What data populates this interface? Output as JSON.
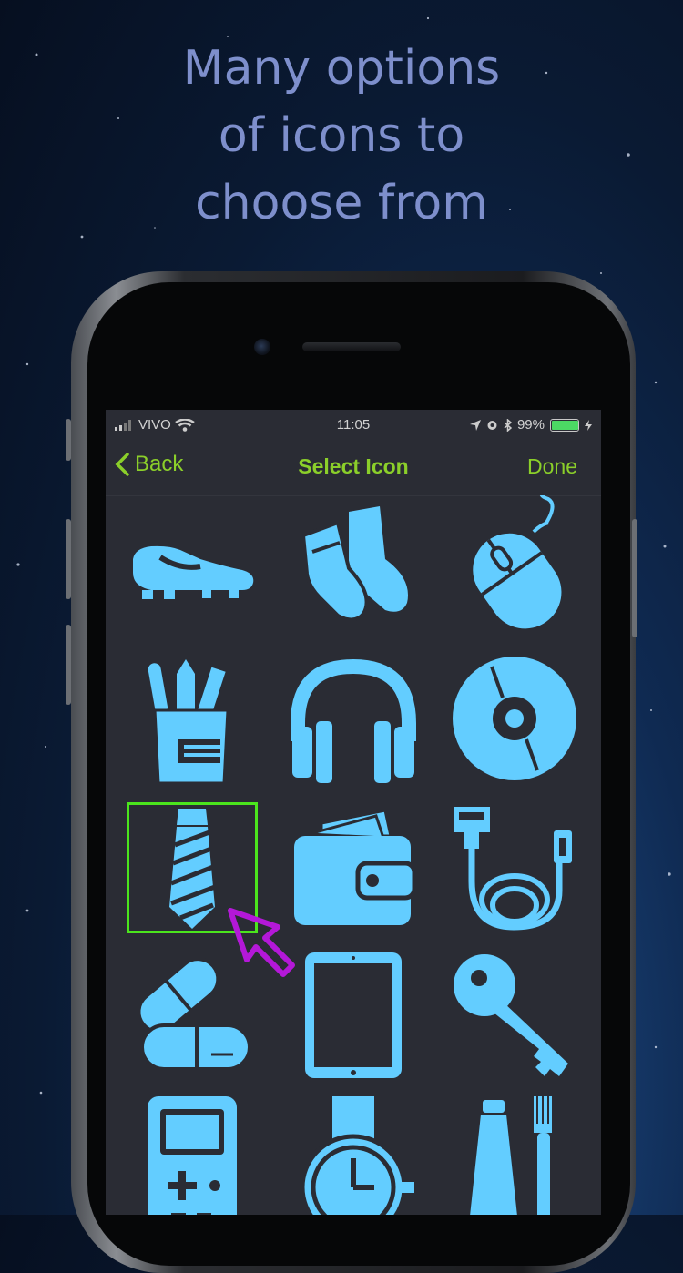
{
  "headline": {
    "line1": "Many options",
    "line2": "of icons to",
    "line3": "choose from"
  },
  "status_bar": {
    "carrier": "VIVO",
    "time": "11:05",
    "battery": "99%"
  },
  "nav": {
    "back_label": "Back",
    "title": "Select Icon",
    "done_label": "Done"
  },
  "icons": [
    "cleat-icon",
    "socks-icon",
    "mouse-icon",
    "pencil-cup-icon",
    "headphones-icon",
    "cd-icon",
    "tie-icon",
    "wallet-icon",
    "cable-icon",
    "pills-icon",
    "tablet-icon",
    "key-icon",
    "gameboy-icon",
    "watch-icon",
    "toothbrush-icon"
  ],
  "selected_icon": "tie-icon",
  "colors": {
    "icon": "#63cdff",
    "accent": "#8bcf2a",
    "selection": "#4be51d",
    "pointer": "#b418d8",
    "headline": "#7e8fcc"
  }
}
